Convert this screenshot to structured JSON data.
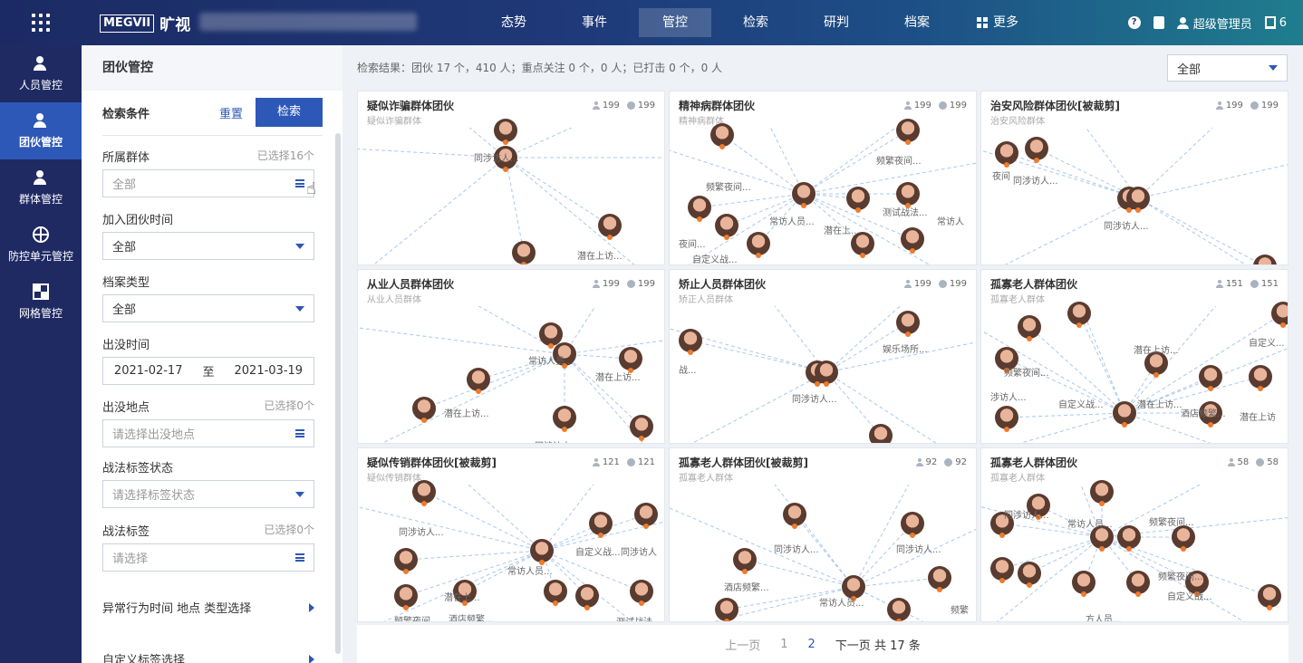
{
  "topbar": {
    "logo_box": "MEGVII",
    "logo_cn": "旷视",
    "nav": [
      "态势",
      "事件",
      "管控",
      "检索",
      "研判",
      "档案"
    ],
    "nav_active": "管控",
    "more_label": "更多",
    "help_glyph": "?",
    "user_name": "超级管理员",
    "msg_count": "6"
  },
  "leftnav": {
    "items": [
      {
        "label": "人员管控",
        "icon": "person-icon"
      },
      {
        "label": "团伙管控",
        "icon": "group-icon"
      },
      {
        "label": "群体管控",
        "icon": "crowd-icon"
      },
      {
        "label": "防控单元管控",
        "icon": "target-icon"
      },
      {
        "label": "网格管控",
        "icon": "grid-icon"
      }
    ],
    "active": "团伙管控"
  },
  "panel": {
    "title": "团伙管控",
    "cond_label": "检索条件",
    "reset_label": "重置",
    "search_label": "检索",
    "fields": {
      "group": {
        "label": "所属群体",
        "count": "已选择16个",
        "value": "全部"
      },
      "join_time": {
        "label": "加入团伙时间",
        "value": "全部"
      },
      "file_type": {
        "label": "档案类型",
        "value": "全部"
      },
      "appear_time": {
        "label": "出没时间",
        "from": "2021-02-17",
        "sep": "至",
        "to": "2021-03-19"
      },
      "appear_place": {
        "label": "出没地点",
        "count": "已选择0个",
        "placeholder": "请选择出没地点"
      },
      "tag_status": {
        "label": "战法标签状态",
        "placeholder": "请选择标签状态"
      },
      "tag": {
        "label": "战法标签",
        "count": "已选择0个",
        "placeholder": "请选择"
      }
    },
    "expand1": "异常行为时间 地点 类型选择",
    "expand2": "自定义标签选择"
  },
  "main": {
    "result_text": "检索结果：团伙 17 个，410 人；重点关注 0 个，0 人；已打击 0 个，0 人",
    "filter_value": "全部",
    "cards": [
      {
        "title": "疑似诈骗群体团伙",
        "sub": "疑似诈骗群体",
        "persons": "199",
        "count": "199",
        "labels": [
          "同涉访人...",
          "潜在上访..."
        ]
      },
      {
        "title": "精神病群体团伙",
        "sub": "精神病群体",
        "persons": "199",
        "count": "199",
        "labels": [
          "频繁夜间...",
          "频繁夜间...",
          "常访人员...",
          "潜在上...",
          "测试战法...",
          "常访人",
          "夜间...",
          "自定义战..."
        ]
      },
      {
        "title": "治安风险群体团伙[被裁剪]",
        "sub": "治安风险群体",
        "persons": "199",
        "count": "199",
        "labels": [
          "夜间",
          "同涉访人...",
          "同涉访人..."
        ]
      },
      {
        "title": "从业人员群体团伙",
        "sub": "从业人员群体",
        "persons": "199",
        "count": "199",
        "labels": [
          "常访人员...",
          "潜在上访...",
          "潜在上访...",
          "同涉访人..."
        ]
      },
      {
        "title": "矫止人员群体团伙",
        "sub": "矫正人员群体",
        "persons": "199",
        "count": "199",
        "labels": [
          "娱乐场所...",
          "战...",
          "同涉访人..."
        ]
      },
      {
        "title": "孤寡老人群体团伙",
        "sub": "孤寡老人群体",
        "persons": "151",
        "count": "151",
        "labels": [
          "潜在上访...",
          "自定义...",
          "频繁夜间...",
          "涉访人...",
          "自定义战...",
          "潜在上访...",
          "酒店频繁...",
          "潜在上访"
        ]
      },
      {
        "title": "疑似传销群体团伙[被裁剪]",
        "sub": "疑似传销群体",
        "persons": "121",
        "count": "121",
        "labels": [
          "同涉访人...",
          "自定义战...",
          "同涉访人",
          "常访人员...",
          "潜在上...",
          "酒店频繁...",
          "测试战法",
          "频繁夜间"
        ]
      },
      {
        "title": "孤寡老人群体团伙[被裁剪]",
        "sub": "孤寡老人群体",
        "persons": "92",
        "count": "92",
        "labels": [
          "同涉访人...",
          "同涉访人...",
          "酒店频繁...",
          "常访人员...",
          "频繁"
        ]
      },
      {
        "title": "孤寡老人群体团伙",
        "sub": "孤寡老人群体",
        "persons": "58",
        "count": "58",
        "labels": [
          "同涉访人...",
          "常访人员...",
          "频繁夜间...",
          "频繁夜间...",
          "自定义战...",
          "方人员..."
        ]
      }
    ],
    "pager": {
      "prev": "上一页",
      "p1": "1",
      "p2": "2",
      "next": "下一页",
      "total": "共 17 条"
    }
  }
}
